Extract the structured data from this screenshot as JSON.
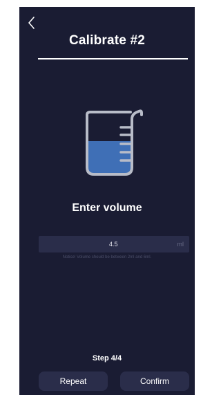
{
  "header": {
    "back_icon": "chevron-left-icon",
    "title": "Calibrate #2"
  },
  "illustration": {
    "icon": "beaker-icon",
    "fill_color": "#3f6fb6",
    "outline_color": "#b8bcc8"
  },
  "prompt": "Enter volume",
  "volume_input": {
    "value": "4.5",
    "unit": "ml"
  },
  "notice": "Notice! Volume should be between 2ml and 6ml.",
  "step": "Step 4/4",
  "buttons": {
    "repeat": "Repeat",
    "confirm": "Confirm"
  },
  "colors": {
    "background": "#1a1c33",
    "field": "#2a2d4a",
    "text": "#ffffff"
  }
}
